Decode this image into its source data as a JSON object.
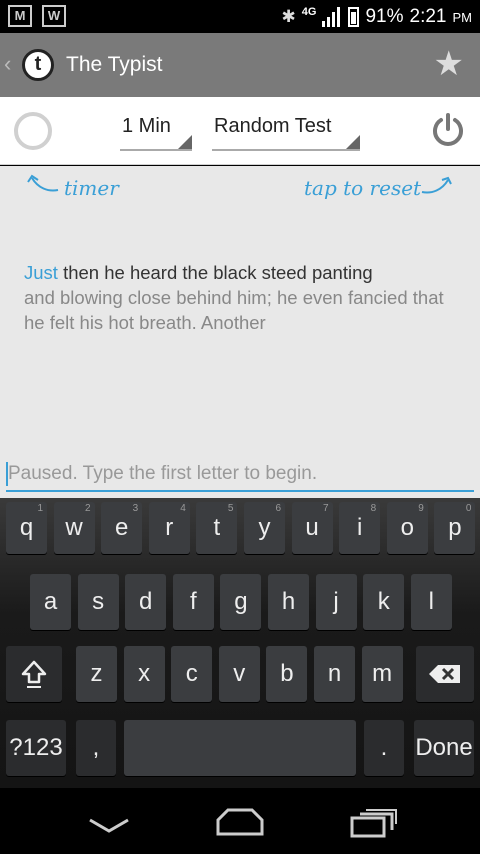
{
  "status_bar": {
    "notif_icons": [
      "gmail-icon",
      "word-icon"
    ],
    "notif_labels": [
      "M",
      "W"
    ],
    "network": "4G",
    "battery": "91%",
    "time": "2:21",
    "ampm": "PM"
  },
  "action_bar": {
    "title": "The Typist",
    "logo_letter": "t"
  },
  "controls": {
    "duration": "1 Min",
    "test_type": "Random Test"
  },
  "hints": {
    "timer": "timer",
    "reset": "tap to reset"
  },
  "passage": {
    "current_word": "Just",
    "rest_line1": " then he heard the black steed panting",
    "remaining": "and blowing close behind him; he even fancied that he felt his hot breath. Another"
  },
  "input": {
    "placeholder": "Paused. Type the first letter to begin."
  },
  "keyboard": {
    "row1": [
      {
        "k": "q",
        "n": "1"
      },
      {
        "k": "w",
        "n": "2"
      },
      {
        "k": "e",
        "n": "3"
      },
      {
        "k": "r",
        "n": "4"
      },
      {
        "k": "t",
        "n": "5"
      },
      {
        "k": "y",
        "n": "6"
      },
      {
        "k": "u",
        "n": "7"
      },
      {
        "k": "i",
        "n": "8"
      },
      {
        "k": "o",
        "n": "9"
      },
      {
        "k": "p",
        "n": "0"
      }
    ],
    "row2": [
      "a",
      "s",
      "d",
      "f",
      "g",
      "h",
      "j",
      "k",
      "l"
    ],
    "row3": [
      "z",
      "x",
      "c",
      "v",
      "b",
      "n",
      "m"
    ],
    "symbols_label": "?123",
    "comma_label": ",",
    "period_label": ".",
    "done_label": "Done"
  },
  "colors": {
    "accent": "#3a9fd6",
    "action_bar": "#7a7a7a"
  }
}
